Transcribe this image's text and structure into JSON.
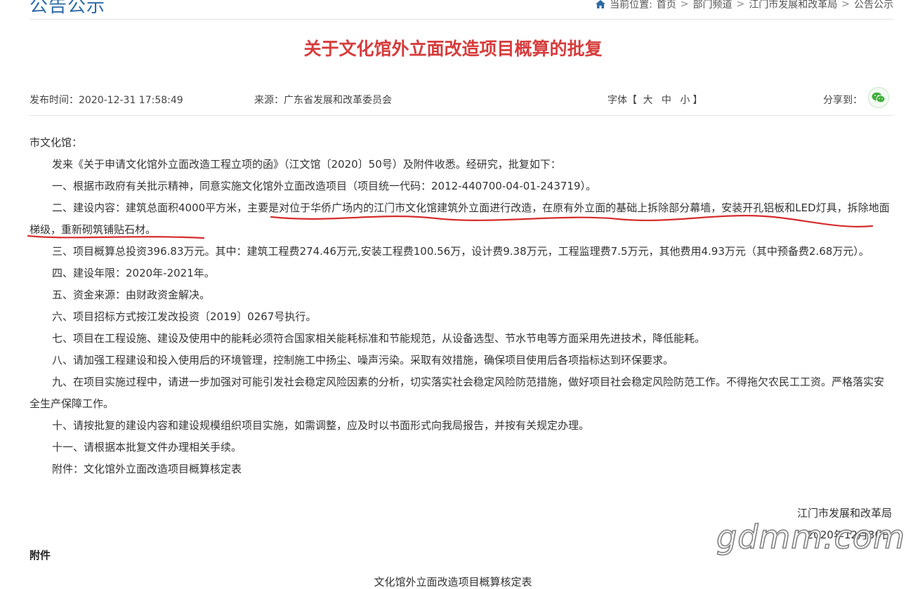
{
  "header": {
    "section_title": "公告公示",
    "breadcrumb": {
      "prefix": "当前位置:",
      "items": [
        "首页",
        "部门频道",
        "江门市发展和改革局",
        "公告公示"
      ],
      "separator": ">"
    }
  },
  "article": {
    "title": "关于文化馆外立面改造项目概算的批复",
    "publish_time": "发布时间：2020-12-31 17:58:49",
    "source": "来源：广东省发展和改革委员会",
    "font_size": {
      "label": "字体",
      "open": "【",
      "large": "大",
      "medium": "中",
      "small": "小",
      "close": "】"
    },
    "share_label": "分享到：",
    "paragraphs": [
      "市文化馆：",
      "发来《关于申请文化馆外立面改造工程立项的函》（江文馆〔2020〕50号）及附件收悉。经研究，批复如下：",
      "一、根据市政府有关批示精神，同意实施文化馆外立面改造项目（项目统一代码：2012-440700-04-01-243719）。",
      "二、建设内容：建筑总面积4000平方米，主要是对位于华侨广场内的江门市文化馆建筑外立面进行改造，在原有外立面的基础上拆除部分幕墙，安装开孔铝板和LED灯具，拆除地面梯级，重新砌筑铺贴石材。",
      "三、项目概算总投资396.83万元。其中：建筑工程费274.46万元,安装工程费100.56万，设计费9.38万元，工程监理费7.5万元，其他费用4.93万元（其中预备费2.68万元）。",
      "四、建设年限：2020年-2021年。",
      "五、资金来源：由财政资金解决。",
      "六、项目招标方式按江发改投资〔2019〕0267号执行。",
      "七、项目在工程设施、建设及使用中的能耗必须符合国家相关能耗标准和节能规范，从设备选型、节水节电等方面采用先进技术，降低能耗。",
      "八、请加强工程建设和投入使用后的环境管理，控制施工中扬尘、噪声污染。采取有效措施，确保项目使用后各项指标达到环保要求。",
      "九、在项目实施过程中，请进一步加强对可能引发社会稳定风险因素的分析，切实落实社会稳定风险防范措施，做好项目社会稳定风险防范工作。不得拖欠农民工工资。严格落实安全生产保障工作。",
      "十、请按批复的建设内容和建设规模组织项目实施，如需调整，应及时以书面形式向我局报告，并按有关规定办理。",
      "十一、请根据本批复文件办理相关手续。",
      "附件：文化馆外立面改造项目概算核定表"
    ],
    "signature": {
      "org": "江门市发展和改革局",
      "date": "2020年12月30日"
    }
  },
  "attachment": {
    "heading": "附件",
    "table_title": "文化馆外立面改造项目概算核定表"
  },
  "watermark": "gdmm.com",
  "colors": {
    "title_red": "#d73c3c",
    "section_blue": "#2d6aa5",
    "annotation_red": "#d62d2d",
    "wechat_green": "#3fae3a"
  }
}
